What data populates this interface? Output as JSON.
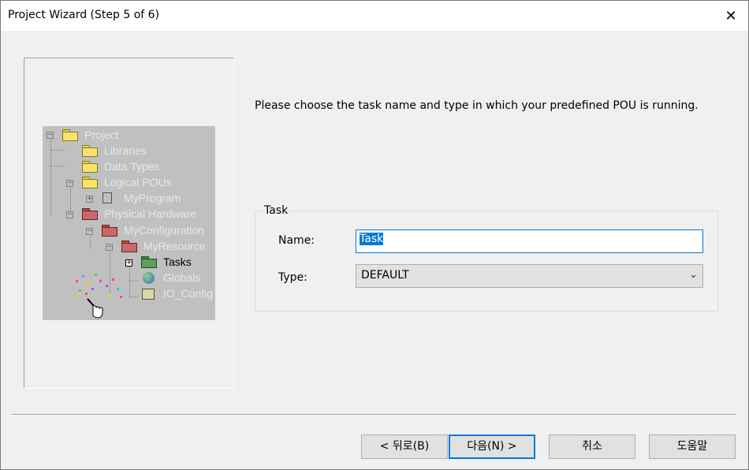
{
  "window": {
    "title": "Project Wizard (Step 5 of 6)",
    "close_glyph": "✕"
  },
  "tree": {
    "items": [
      {
        "label": "Project"
      },
      {
        "label": "Libraries"
      },
      {
        "label": "Data Types"
      },
      {
        "label": "Logical POUs"
      },
      {
        "label": "MyProgram"
      },
      {
        "label": "Physical Hardware"
      },
      {
        "label": "MyConfiguration"
      },
      {
        "label": "MyResource"
      },
      {
        "label": "Tasks"
      },
      {
        "label": "Globals"
      },
      {
        "label": "IO_Config"
      }
    ]
  },
  "main": {
    "instruction": "Please choose the task name and type in which your predefined POU is running.",
    "group_title": "Task",
    "name_label": "Name:",
    "name_value": "Task",
    "type_label": "Type:",
    "type_value": "DEFAULT"
  },
  "buttons": {
    "back": "< 뒤로(B)",
    "next": "다음(N) >",
    "cancel": "취소",
    "help": "도움말"
  },
  "colors": {
    "accent": "#0078d7",
    "dialog_bg": "#f0f0f0"
  }
}
